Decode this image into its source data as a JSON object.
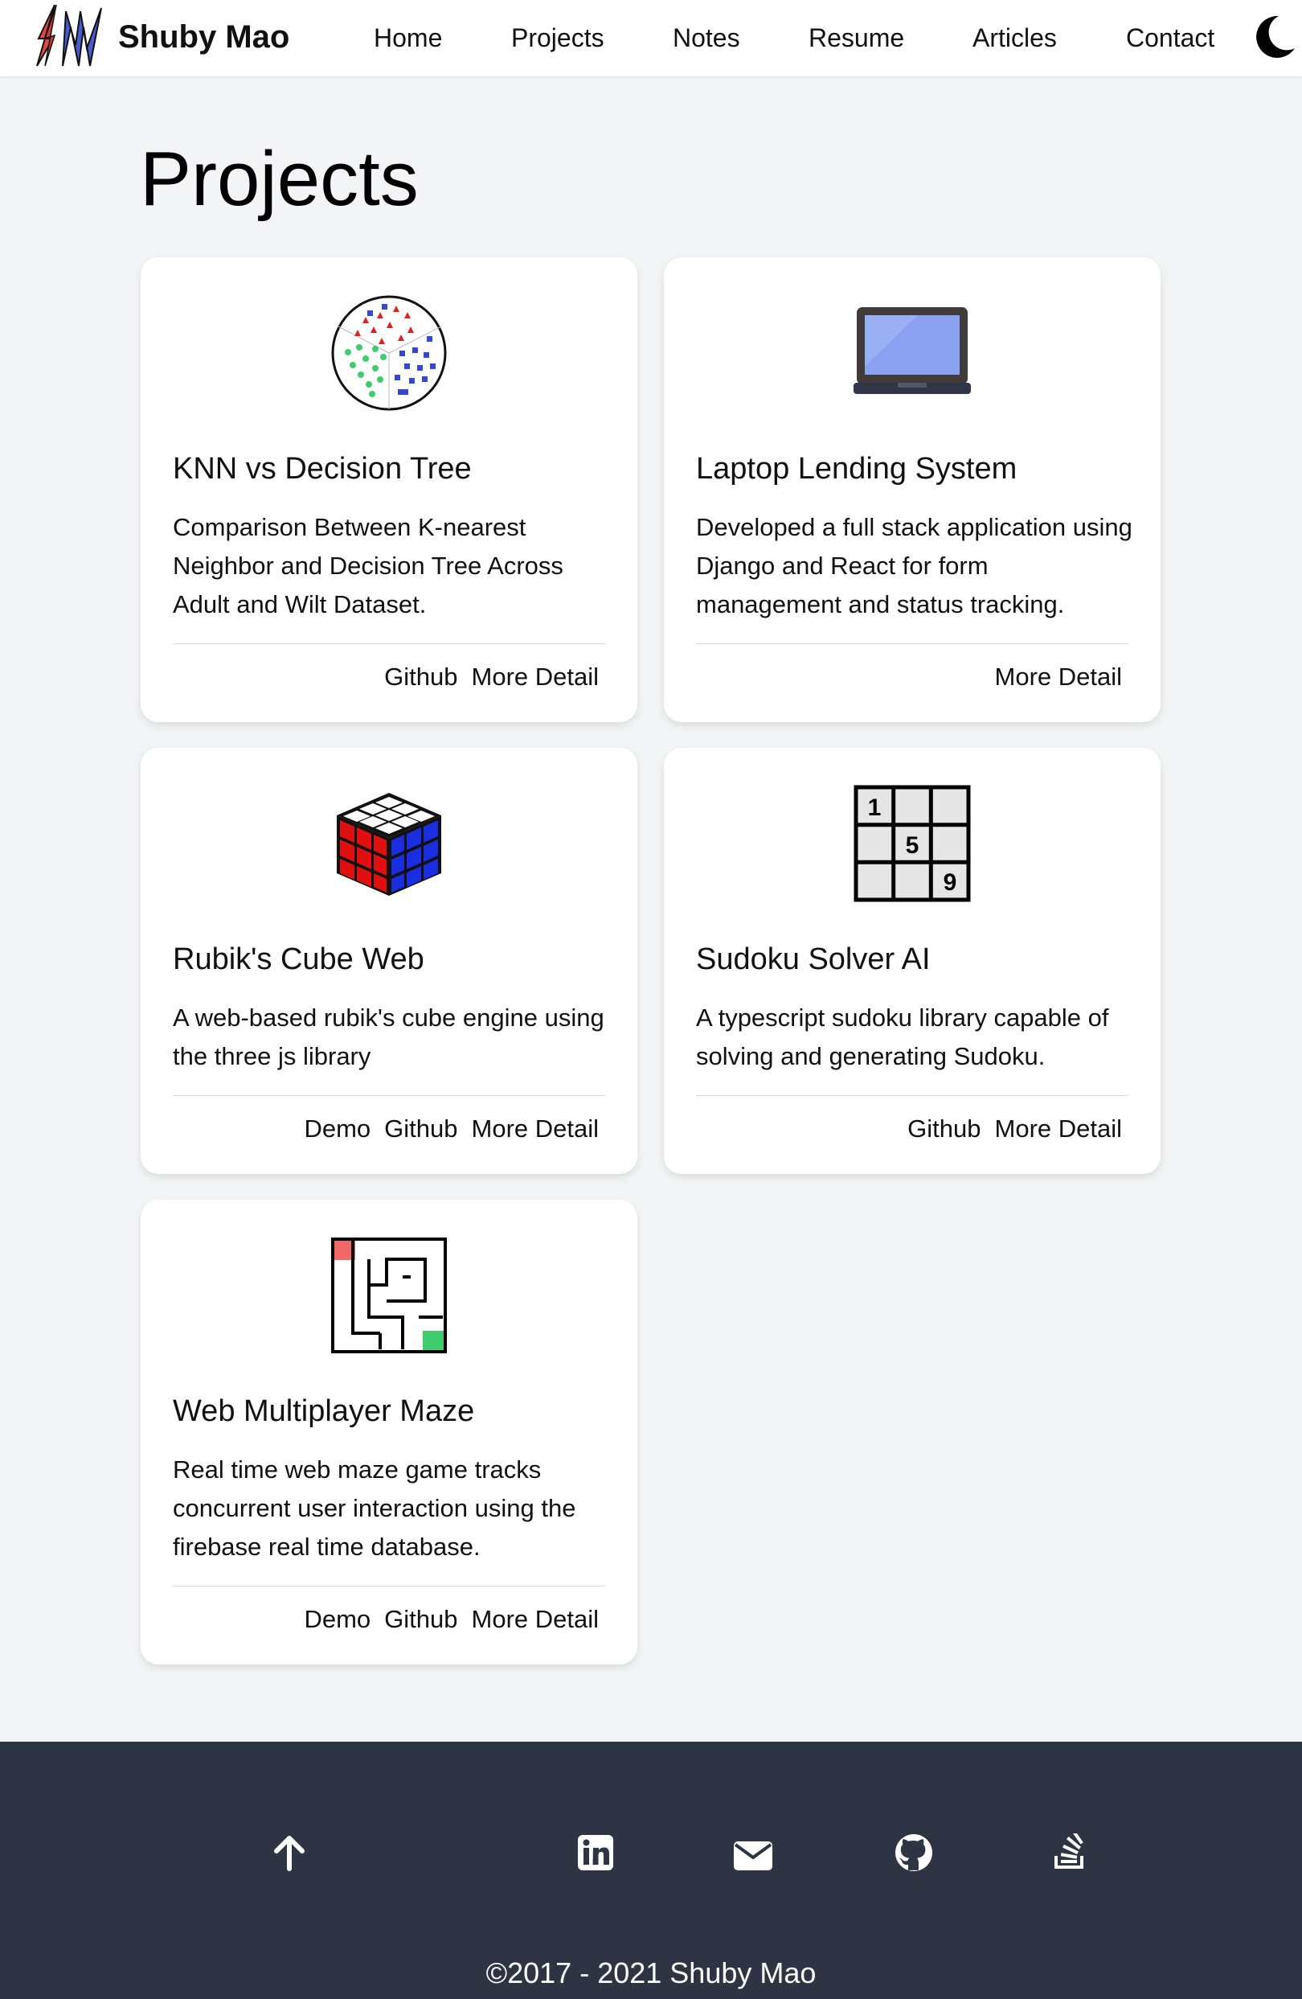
{
  "brand": {
    "name": "Shuby Mao"
  },
  "nav": {
    "links": [
      "Home",
      "Projects",
      "Notes",
      "Resume",
      "Articles",
      "Contact"
    ]
  },
  "main": {
    "title": "Projects",
    "cards": [
      {
        "title": "KNN vs Decision Tree",
        "description": "Comparison Between K-nearest Neighbor and Decision Tree Across Adult and Wilt Dataset.",
        "actions": [
          "Github",
          "More Detail"
        ],
        "icon": "knn-scatter-icon"
      },
      {
        "title": "Laptop Lending System",
        "description": "Developed a full stack application using Django and React for form management and status tracking.",
        "actions": [
          "More Detail"
        ],
        "icon": "laptop-icon"
      },
      {
        "title": "Rubik's Cube Web",
        "description": "A web-based rubik's cube engine using the three js library",
        "actions": [
          "Demo",
          "Github",
          "More Detail"
        ],
        "icon": "rubiks-cube-icon"
      },
      {
        "title": "Sudoku Solver AI",
        "description": "A typescript sudoku library capable of solving and generating Sudoku.",
        "actions": [
          "Github",
          "More Detail"
        ],
        "icon": "sudoku-grid-icon",
        "grid_digits": [
          "1",
          "5",
          "9"
        ]
      },
      {
        "title": "Web Multiplayer Maze",
        "description": "Real time web maze game tracks concurrent user interaction using the firebase real time database.",
        "actions": [
          "Demo",
          "Github",
          "More Detail"
        ],
        "icon": "maze-icon"
      }
    ]
  },
  "footer": {
    "icons": [
      "arrow-up-icon",
      "linkedin-icon",
      "mail-icon",
      "github-icon",
      "stackoverflow-icon"
    ],
    "copyright": "©2017 - 2021 Shuby Mao"
  },
  "colors": {
    "page_bg": "#f3f4f6",
    "footer_bg": "#2e3443",
    "card_bg": "#ffffff"
  }
}
